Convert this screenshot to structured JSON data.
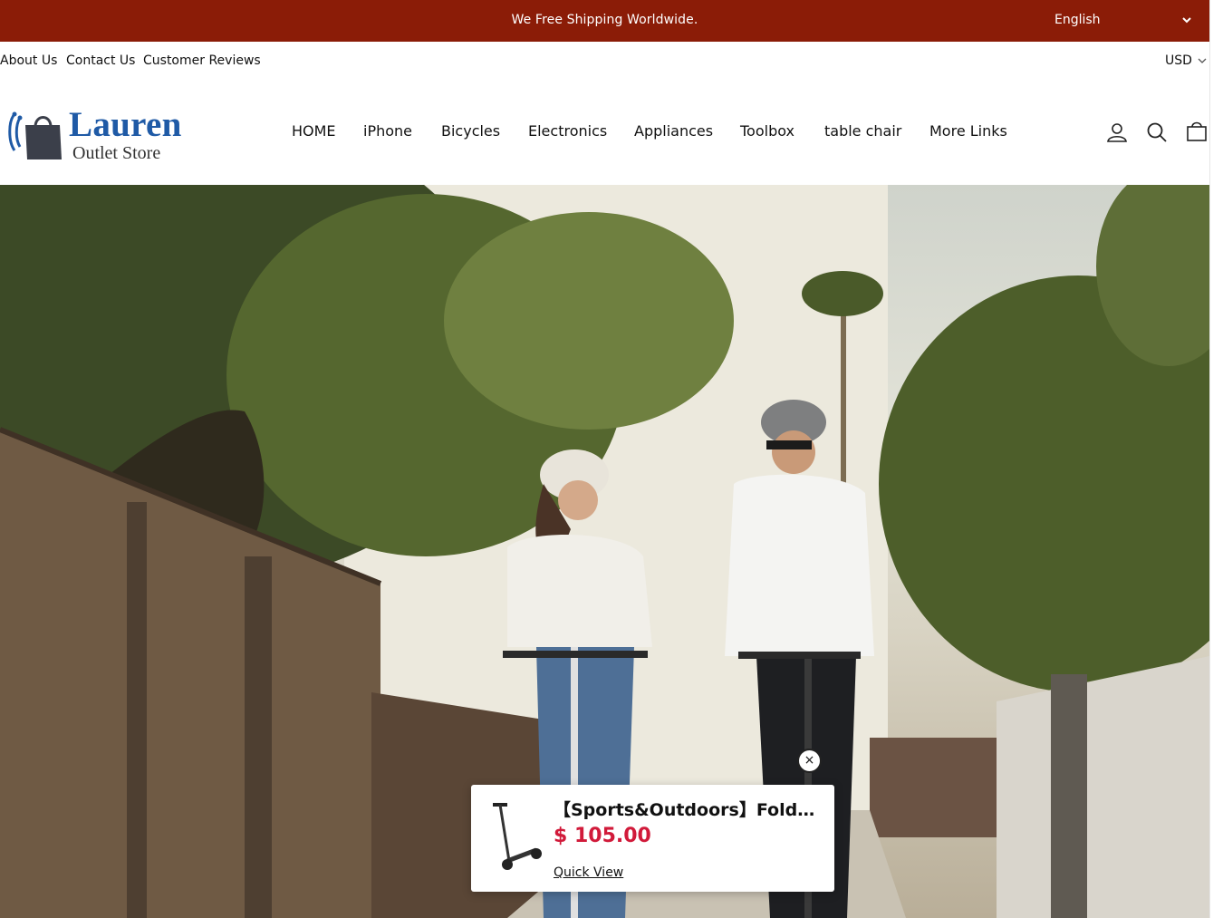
{
  "announcement": {
    "text": "We Free Shipping Worldwide.",
    "language": "English"
  },
  "utility_links": [
    "About Us",
    "Contact Us",
    "Customer Reviews"
  ],
  "currency": "USD",
  "logo": {
    "main": "Lauren",
    "sub": "Outlet Store"
  },
  "nav": [
    "HOME",
    "iPhone",
    "Bicycles",
    "Electronics",
    "Appliances",
    "Toolbox",
    "table chair",
    "More Links"
  ],
  "header_icons": [
    "account-icon",
    "search-icon",
    "cart-icon"
  ],
  "popup": {
    "title": "【Sports&Outdoors】Foldable Electric Scooter",
    "price": "$ 105.00",
    "link": "Quick View",
    "close": "×"
  },
  "colors": {
    "announcement_bg": "#8b1c07",
    "price": "#d11a3a",
    "logo_blue": "#1f5aa6"
  }
}
